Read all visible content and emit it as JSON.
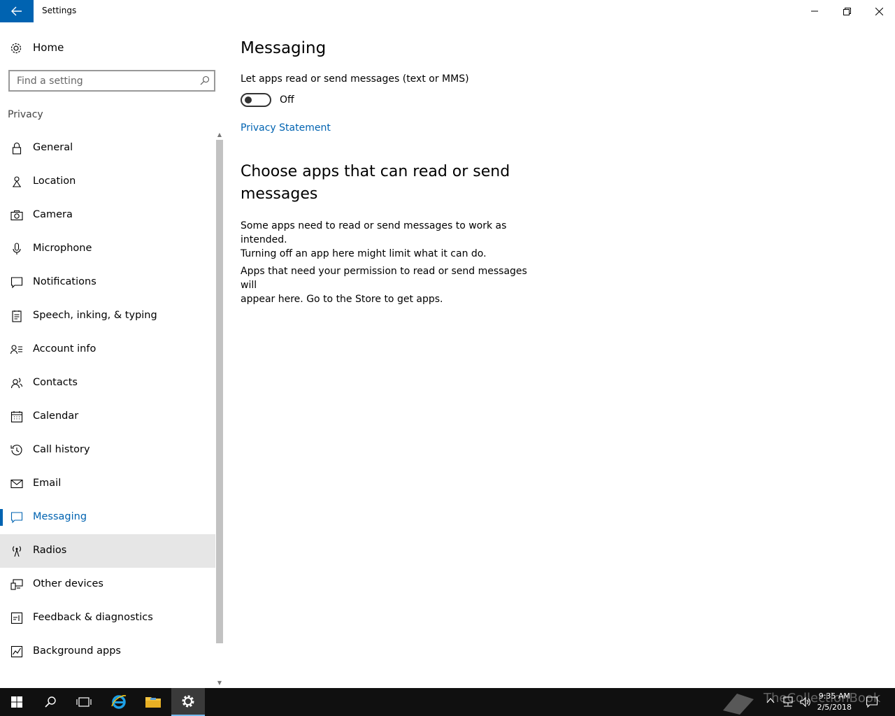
{
  "window": {
    "title": "Settings"
  },
  "sidebar": {
    "home_label": "Home",
    "search_placeholder": "Find a setting",
    "section_title": "Privacy",
    "items": [
      {
        "label": "General",
        "icon": "lock-icon"
      },
      {
        "label": "Location",
        "icon": "location-icon"
      },
      {
        "label": "Camera",
        "icon": "camera-icon"
      },
      {
        "label": "Microphone",
        "icon": "microphone-icon"
      },
      {
        "label": "Notifications",
        "icon": "notifications-icon"
      },
      {
        "label": "Speech, inking, & typing",
        "icon": "speech-icon"
      },
      {
        "label": "Account info",
        "icon": "account-info-icon"
      },
      {
        "label": "Contacts",
        "icon": "contacts-icon"
      },
      {
        "label": "Calendar",
        "icon": "calendar-icon"
      },
      {
        "label": "Call history",
        "icon": "call-history-icon"
      },
      {
        "label": "Email",
        "icon": "email-icon"
      },
      {
        "label": "Messaging",
        "icon": "messaging-icon",
        "selected": true
      },
      {
        "label": "Radios",
        "icon": "radios-icon",
        "hover": true
      },
      {
        "label": "Other devices",
        "icon": "other-devices-icon"
      },
      {
        "label": "Feedback & diagnostics",
        "icon": "feedback-icon"
      },
      {
        "label": "Background apps",
        "icon": "background-apps-icon"
      }
    ]
  },
  "main": {
    "title": "Messaging",
    "setting_label": "Let apps read or send messages (text or MMS)",
    "toggle_state": "Off",
    "privacy_link": "Privacy Statement",
    "section_title": "Choose apps that can read or send messages",
    "para1_line1": "Some apps need to read or send messages to work as intended.",
    "para1_line2": "Turning off an app here might limit what it can do.",
    "para2_line1": "Apps that need your permission to read or send messages will",
    "para2_line2": "appear here. Go to the Store to get apps."
  },
  "taskbar": {
    "time": "9:35 AM",
    "date": "2/5/2018",
    "watermark": "TheCollectionBook"
  },
  "colors": {
    "accent": "#0063b1",
    "hover": "#e6e6e6",
    "taskbar": "#101010"
  }
}
